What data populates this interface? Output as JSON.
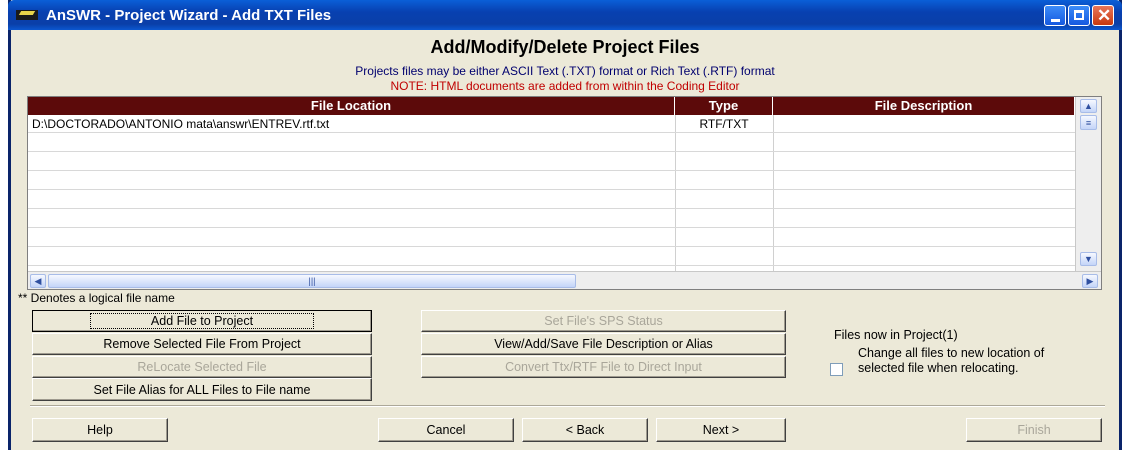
{
  "window": {
    "title": "AnSWR - Project Wizard - Add TXT Files"
  },
  "heading": "Add/Modify/Delete Project Files",
  "subtitle": "Projects files may be either ASCII Text (.TXT) format or Rich Text (.RTF) format",
  "note": "NOTE: HTML documents are added from within the Coding Editor",
  "grid": {
    "columns": [
      "File Location",
      "Type",
      "File Description"
    ],
    "rows": [
      {
        "location": "D:\\DOCTORADO\\ANTONIO mata\\answr\\ENTREV.rtf.txt",
        "type": "RTF/TXT",
        "description": ""
      }
    ]
  },
  "legend_note": "** Denotes a logical file name",
  "buttons": {
    "add_file": "Add File to Project",
    "remove_file": "Remove Selected File From Project",
    "relocate": "ReLocate Selected File",
    "set_alias_all": "Set File Alias for ALL Files to File name",
    "set_sps": "Set File's SPS Status",
    "view_desc": "View/Add/Save File Description or Alias",
    "convert": "Convert Ttx/RTF File to Direct Input"
  },
  "files_now": "Files now in Project(1)",
  "relocate_option": {
    "label": "Change all files to new location of selected file when relocating.",
    "checked": false
  },
  "nav": {
    "help": "Help",
    "cancel": "Cancel",
    "back": "< Back",
    "next": "Next >",
    "finish": "Finish"
  },
  "icons": [
    "app-icon",
    "minimize-icon",
    "maximize-icon",
    "close-icon",
    "scroll-up-icon",
    "scroll-down-icon",
    "scroll-left-icon",
    "scroll-right-icon"
  ],
  "colors": {
    "titlebar": "#0a4fc8",
    "grid_header": "#5c0a0a",
    "subtitle": "#00006e",
    "note": "#c00000"
  }
}
